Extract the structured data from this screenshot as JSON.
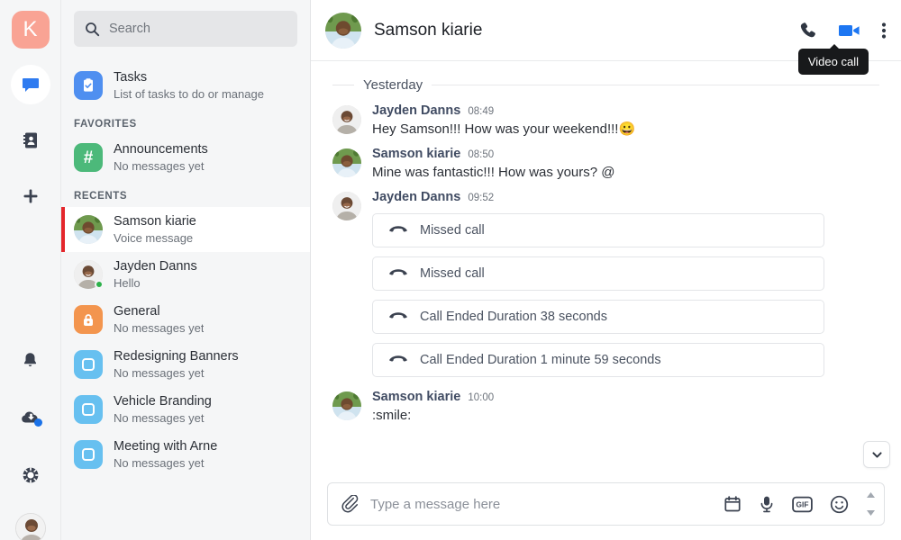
{
  "rail": {
    "logo_letter": "K",
    "items": [
      {
        "name": "chat-icon",
        "label": "Chat",
        "active": true
      },
      {
        "name": "contacts-icon",
        "label": "Contacts",
        "active": false
      },
      {
        "name": "plus-icon",
        "label": "Add",
        "active": false
      }
    ],
    "bottom_items": [
      {
        "name": "bell-icon",
        "label": "Notifications"
      },
      {
        "name": "cloud-download-icon",
        "label": "Downloads",
        "badge": true
      },
      {
        "name": "help-icon",
        "label": "Help"
      }
    ],
    "avatar_label": "My profile"
  },
  "search": {
    "placeholder": "Search",
    "value": "",
    "icon": "search-icon"
  },
  "sidebar": {
    "tasks": {
      "title": "Tasks",
      "subtitle": "List of tasks to do or manage",
      "icon": "tasks-clipboard-icon"
    },
    "favorites_label": "FAVORITES",
    "favorites": [
      {
        "title": "Announcements",
        "subtitle": "No messages yet",
        "icon": "hash-icon",
        "tile": "green"
      }
    ],
    "recents_label": "RECENTS",
    "recents": [
      {
        "title": "Samson kiarie",
        "subtitle": "Voice message",
        "icon": "avatar",
        "avatar": "samson",
        "selected": true,
        "presence": false
      },
      {
        "title": "Jayden Danns",
        "subtitle": "Hello",
        "icon": "avatar",
        "avatar": "jayden",
        "selected": false,
        "presence": true
      },
      {
        "title": "General",
        "subtitle": "No messages yet",
        "icon": "lock-icon",
        "tile": "orange",
        "selected": false
      },
      {
        "title": "Redesigning Banners",
        "subtitle": "No messages yet",
        "icon": "square-icon",
        "tile": "lblue",
        "selected": false
      },
      {
        "title": "Vehicle Branding",
        "subtitle": "No messages yet",
        "icon": "square-icon",
        "tile": "lblue",
        "selected": false
      },
      {
        "title": "Meeting with Arne",
        "subtitle": "No messages yet",
        "icon": "square-icon",
        "tile": "lblue",
        "selected": false
      }
    ]
  },
  "header": {
    "name": "Samson kiarie",
    "actions": [
      {
        "name": "audio-call-icon",
        "label": "Audio call",
        "active": false
      },
      {
        "name": "video-call-icon",
        "label": "Video call",
        "active": true
      },
      {
        "name": "more-options-icon",
        "label": "More options",
        "active": false
      }
    ],
    "tooltip": "Video call"
  },
  "conversation": {
    "day_divider": "Yesterday",
    "messages": [
      {
        "author": "Jayden Danns",
        "time": "08:49",
        "avatar": "jayden",
        "text": "Hey Samson!!! How was your weekend!!!😀",
        "type": "text"
      },
      {
        "author": "Samson kiarie",
        "time": "08:50",
        "avatar": "samson",
        "text": "Mine was fantastic!!! How was yours? @",
        "type": "text"
      },
      {
        "author": "Jayden Danns",
        "time": "09:52",
        "avatar": "jayden",
        "type": "calls",
        "calls": [
          {
            "label": "Missed call",
            "icon": "call-ended-icon"
          },
          {
            "label": "Missed call",
            "icon": "call-ended-icon"
          },
          {
            "label": "Call Ended Duration 38 seconds",
            "icon": "call-ended-icon"
          },
          {
            "label": "Call Ended Duration 1 minute 59 seconds",
            "icon": "call-ended-icon"
          }
        ]
      },
      {
        "author": "Samson kiarie",
        "time": "10:00",
        "avatar": "samson",
        "text": ":smile:",
        "type": "text"
      }
    ],
    "scroll_down_icon": "chevron-down-icon"
  },
  "composer": {
    "attach_icon": "paperclip-icon",
    "placeholder": "Type a message here",
    "value": "",
    "icons": [
      {
        "name": "calendar-icon",
        "label": "Schedule"
      },
      {
        "name": "microphone-icon",
        "label": "Voice message"
      },
      {
        "name": "gif-icon",
        "label": "GIF"
      },
      {
        "name": "emoji-icon",
        "label": "Emoji"
      }
    ]
  },
  "colors": {
    "logo_bg": "#f9a394",
    "accent_blue": "#1b72e8",
    "selected_indicator": "#e4262b",
    "presence_online": "#2db14a",
    "tooltip_bg": "#18191b"
  }
}
